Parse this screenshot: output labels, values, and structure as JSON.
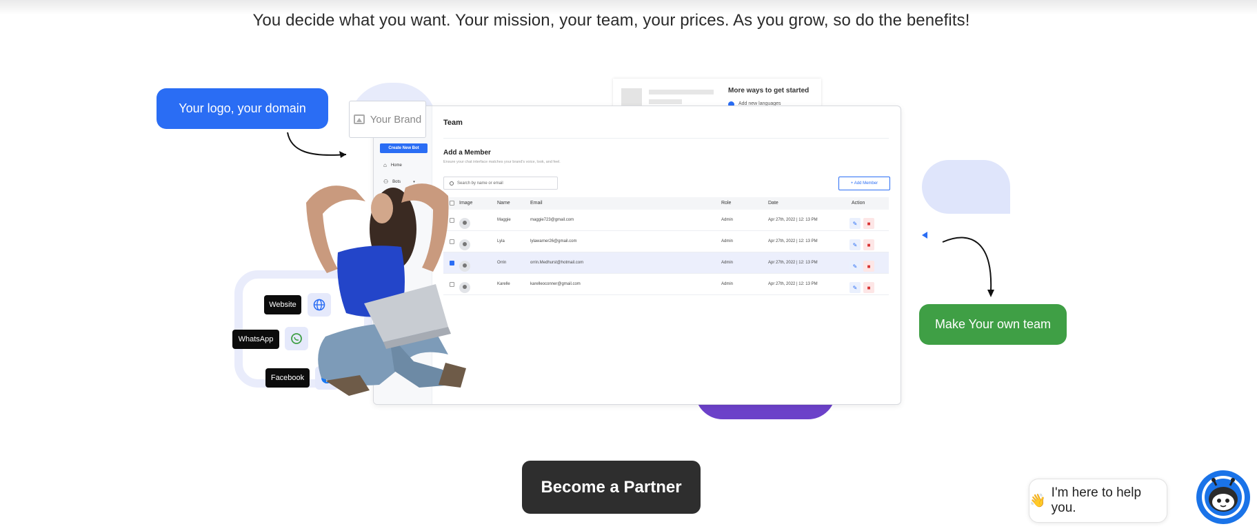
{
  "tagline": "You decide what you want. Your mission, your team, your prices. As you grow, so do the benefits!",
  "callouts": {
    "logo_domain": "Your logo, your domain",
    "own_team": "Make Your own team"
  },
  "brand_placeholder": "Your Brand",
  "bg_card": {
    "title": "More ways to get started",
    "item": "Add new languages"
  },
  "dashboard": {
    "create_bot": "Create New Bot",
    "sidebar": [
      {
        "label": "Home",
        "icon": "home-icon"
      },
      {
        "label": "Bots",
        "icon": "bots-icon"
      }
    ],
    "page_title": "Team",
    "add_member_title": "Add a Member",
    "add_member_subtitle": "Ensure your chat interface matches your brand's voice, look, and feel.",
    "search_placeholder": "Search by name or email",
    "add_member_button": "+ Add Member",
    "columns": [
      "Image",
      "Name",
      "Email",
      "Role",
      "Date",
      "Action"
    ],
    "rows": [
      {
        "name": "Maggie",
        "email": "maggie723@gmail.com",
        "role": "Admin",
        "date": "Apr 27th, 2022 | 12: 13 PM",
        "selected": false
      },
      {
        "name": "Lyla",
        "email": "lylawarner26@gmail.com",
        "role": "Admin",
        "date": "Apr 27th, 2022 | 12: 13 PM",
        "selected": false
      },
      {
        "name": "Orrin",
        "email": "orrin.Medhurst@hotmail.com",
        "role": "Admin",
        "date": "Apr 27th, 2022 | 12: 13 PM",
        "selected": true
      },
      {
        "name": "Karelle",
        "email": "karelleoconner@gmail.com",
        "role": "Admin",
        "date": "Apr 27th, 2022 | 12: 13 PM",
        "selected": false
      }
    ]
  },
  "channels": {
    "website": "Website",
    "whatsapp": "WhatsApp",
    "facebook": "Facebook"
  },
  "cta": {
    "label": "Become a Partner"
  },
  "help_widget": {
    "emoji": "👋",
    "text": "I'm here to help you."
  },
  "colors": {
    "brand_blue": "#2a6df4",
    "team_green": "#3f9f45",
    "accent_purple": "#6c41c9",
    "cta_dark": "#2e2e2e"
  }
}
